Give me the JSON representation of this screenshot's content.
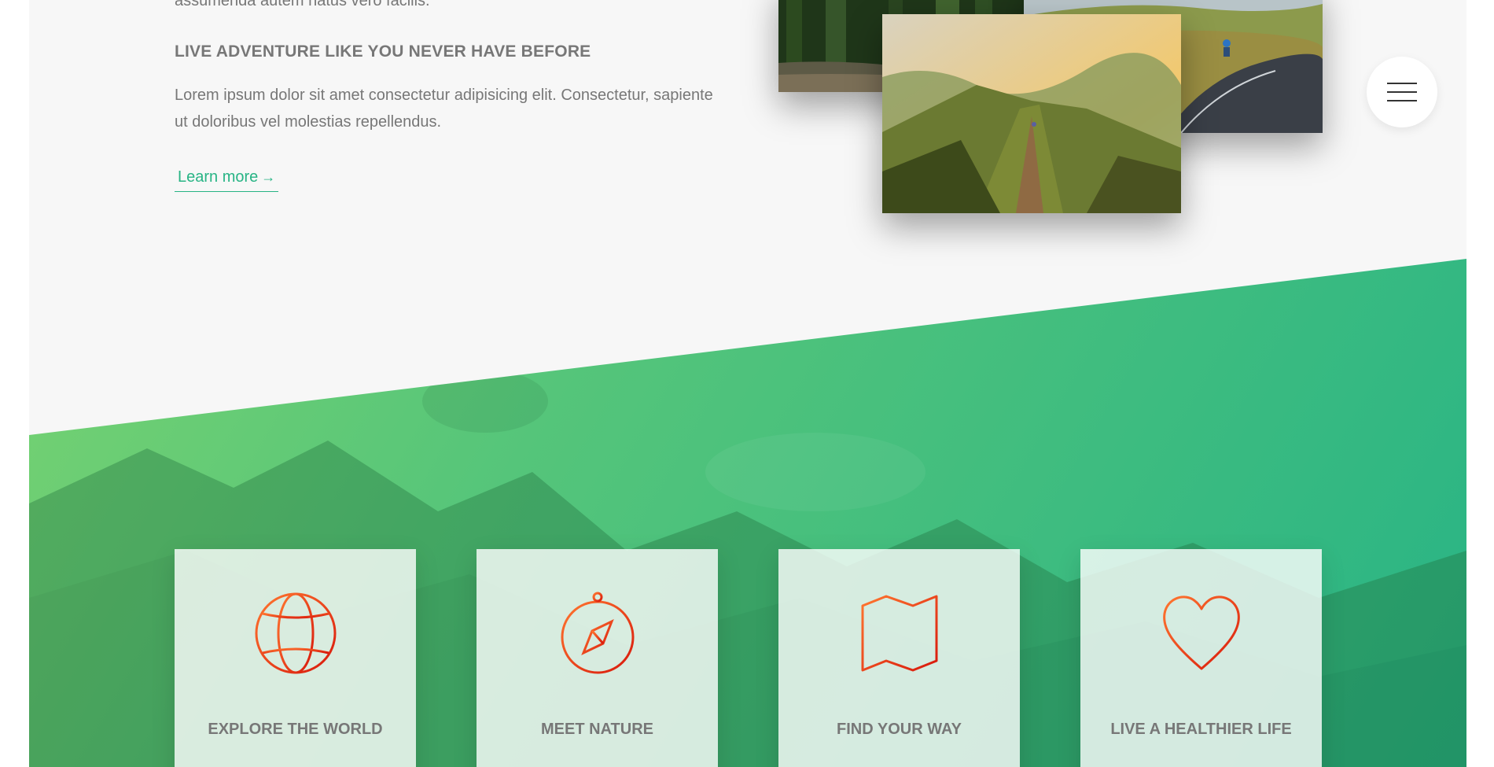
{
  "intro": {
    "cut_line": "assumenda autem natus vero facilis.",
    "heading": "LIVE ADVENTURE LIKE YOU NEVER HAVE BEFORE",
    "paragraph": "Lorem ipsum dolor sit amet consectetur adipisicing elit. Consectetur, sapiente ut doloribus vel molestias repellendus.",
    "learn_more": "Learn more",
    "learn_more_arrow": "→"
  },
  "photos": [
    "forest-lake-photo",
    "road-cyclist-photo",
    "mountain-ridge-hiker-photo"
  ],
  "menu": {
    "icon": "hamburger-menu-icon"
  },
  "features": [
    {
      "icon": "globe-icon",
      "title": "EXPLORE THE WORLD"
    },
    {
      "icon": "compass-icon",
      "title": "MEET NATURE"
    },
    {
      "icon": "map-icon",
      "title": "FIND YOUR WAY"
    },
    {
      "icon": "heart-icon",
      "title": "LIVE A HEALTHIER LIFE"
    }
  ],
  "colors": {
    "background": "#f7f7f7",
    "text_grey": "#777777",
    "accent_green": "#28b485",
    "green_light": "#7ed56f",
    "icon_gradient_start": "#ff7730",
    "icon_gradient_end": "#d8180c"
  }
}
